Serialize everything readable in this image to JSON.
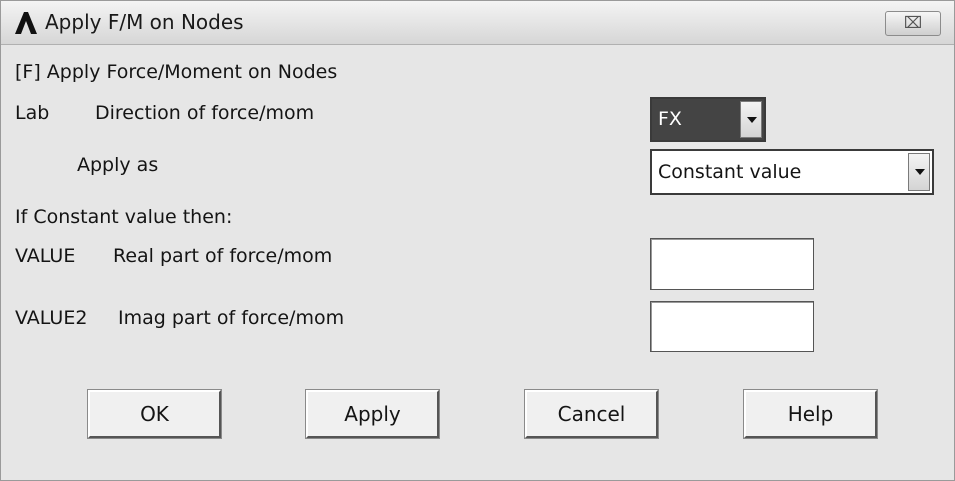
{
  "window": {
    "title": "Apply F/M on Nodes",
    "close_label": "⌧"
  },
  "dialog": {
    "header": "[F]  Apply Force/Moment on Nodes",
    "lab_key": "Lab",
    "lab_desc": "Direction of force/mom",
    "lab_value": "FX",
    "apply_as_label": "Apply as",
    "apply_as_value": "Constant value",
    "constant_header": "If Constant value then:",
    "value_key": "VALUE",
    "value_desc": "Real part of force/mom",
    "value_input": "",
    "value2_key": "VALUE2",
    "value2_desc": "Imag part of force/mom",
    "value2_input": ""
  },
  "buttons": {
    "ok": "OK",
    "apply": "Apply",
    "cancel": "Cancel",
    "help": "Help"
  },
  "icons": {
    "app": "ansys-logo-icon",
    "close": "close-icon",
    "dropdown": "chevron-down-icon"
  },
  "colors": {
    "selected_combo_bg": "#444444",
    "selected_combo_text": "#ffffff",
    "dialog_bg": "#e6e6e6"
  }
}
